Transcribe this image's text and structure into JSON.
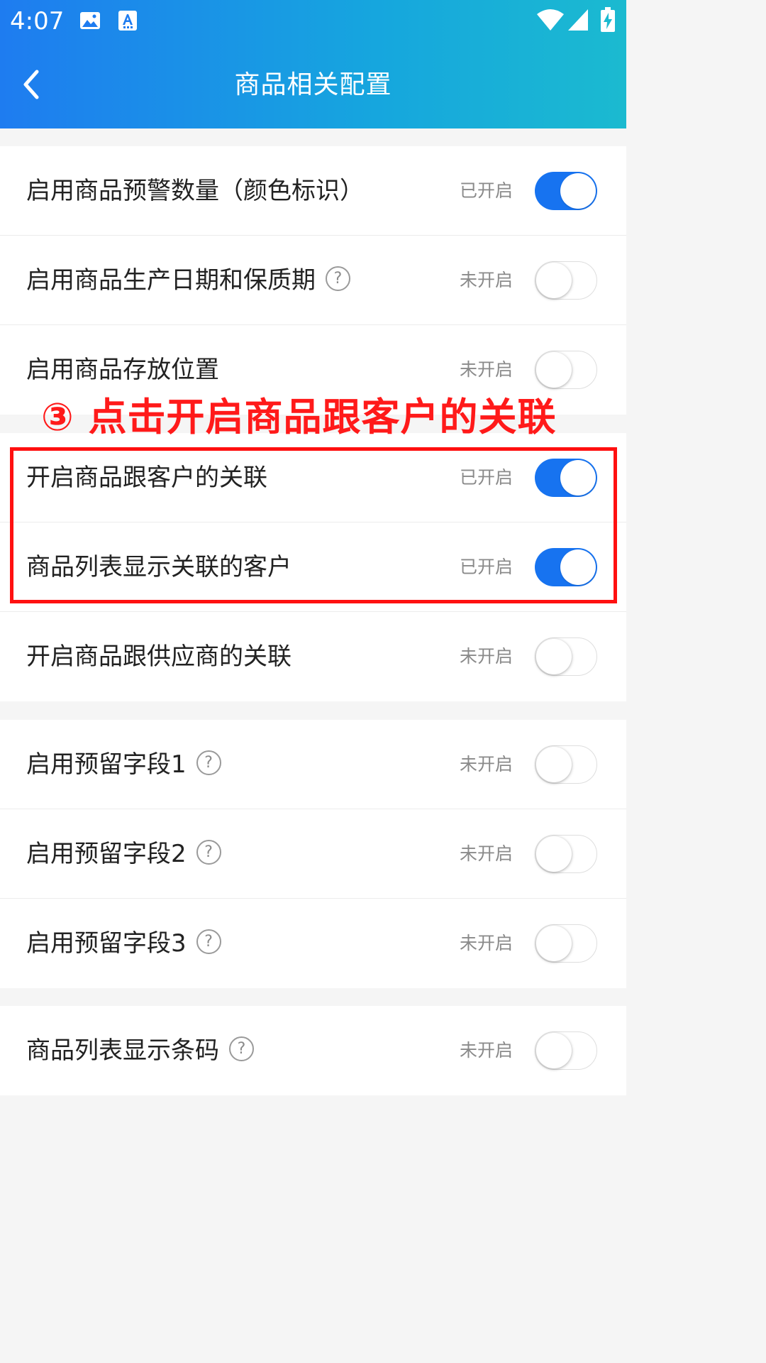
{
  "status_bar": {
    "time": "4:07",
    "icons": [
      "image-icon",
      "font-icon",
      "wifi-icon",
      "signal-icon",
      "battery-charging-icon"
    ]
  },
  "app_bar": {
    "back_icon": "chevron-left-icon",
    "title": "商品相关配置"
  },
  "colors": {
    "accent": "#1773f0",
    "appbar_gradient": [
      "#1e7cf0",
      "#1bbad0"
    ],
    "annotation": "#ff1a1a"
  },
  "annotation": {
    "text": "③ 点击开启商品跟客户的关联"
  },
  "groups": [
    {
      "rows": [
        {
          "label": "启用商品预警数量（颜色标识）",
          "state": "已开启",
          "on": true,
          "help": false
        },
        {
          "label": "启用商品生产日期和保质期",
          "state": "未开启",
          "on": false,
          "help": true
        },
        {
          "label": "启用商品存放位置",
          "state": "未开启",
          "on": false,
          "help": false
        }
      ]
    },
    {
      "rows": [
        {
          "label": "开启商品跟客户的关联",
          "state": "已开启",
          "on": true,
          "help": false
        },
        {
          "label": "商品列表显示关联的客户",
          "state": "已开启",
          "on": true,
          "help": false
        },
        {
          "label": "开启商品跟供应商的关联",
          "state": "未开启",
          "on": false,
          "help": false
        }
      ]
    },
    {
      "rows": [
        {
          "label": "启用预留字段1",
          "state": "未开启",
          "on": false,
          "help": true
        },
        {
          "label": "启用预留字段2",
          "state": "未开启",
          "on": false,
          "help": true
        },
        {
          "label": "启用预留字段3",
          "state": "未开启",
          "on": false,
          "help": true
        }
      ]
    },
    {
      "rows": [
        {
          "label": "商品列表显示条码",
          "state": "未开启",
          "on": false,
          "help": true
        }
      ]
    }
  ]
}
